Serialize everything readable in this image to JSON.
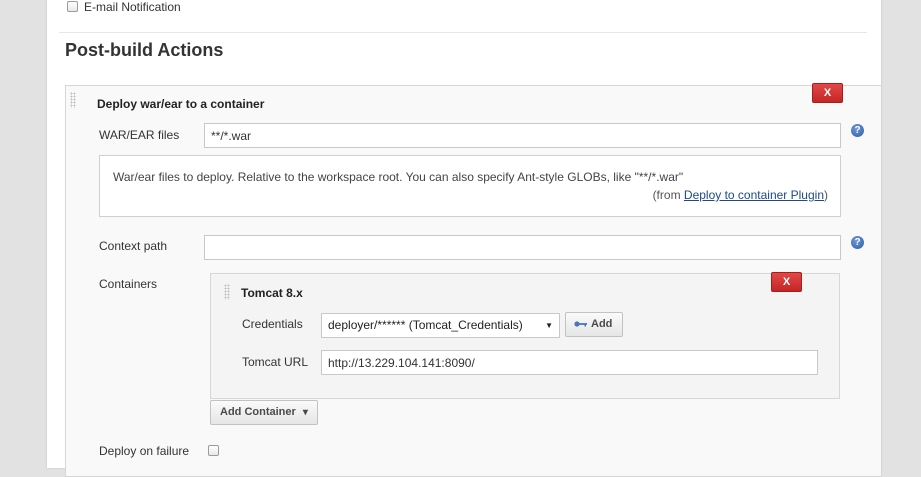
{
  "email_notification": {
    "label": "E-mail Notification"
  },
  "post_build": {
    "title": "Post-build Actions",
    "deploy": {
      "title": "Deploy war/ear to a container",
      "delete_label": "X",
      "war_files": {
        "label": "WAR/EAR files",
        "value": "**/*.war"
      },
      "help_text": "War/ear files to deploy. Relative to the workspace root. You can also specify Ant-style GLOBs, like \"**/*.war\"",
      "help_from_prefix": "(from ",
      "help_from_link": "Deploy to container Plugin",
      "help_from_suffix": ")",
      "context_path": {
        "label": "Context path",
        "value": ""
      },
      "containers_label": "Containers",
      "container": {
        "title": "Tomcat 8.x",
        "delete_label": "X",
        "credentials_label": "Credentials",
        "credentials_value": "deployer/****** (Tomcat_Credentials)",
        "add_label": "Add",
        "tomcat_url_label": "Tomcat URL",
        "tomcat_url_value": "http://13.229.104.141:8090/"
      },
      "add_container_label": "Add Container",
      "deploy_on_failure_label": "Deploy on failure"
    }
  },
  "icons": {
    "help": "?",
    "dropdown_arrow": "▼",
    "caret": "▾"
  },
  "colors": {
    "delete_button": "#d63333",
    "help_icon": "#2a5ea8",
    "link": "#204a87"
  }
}
